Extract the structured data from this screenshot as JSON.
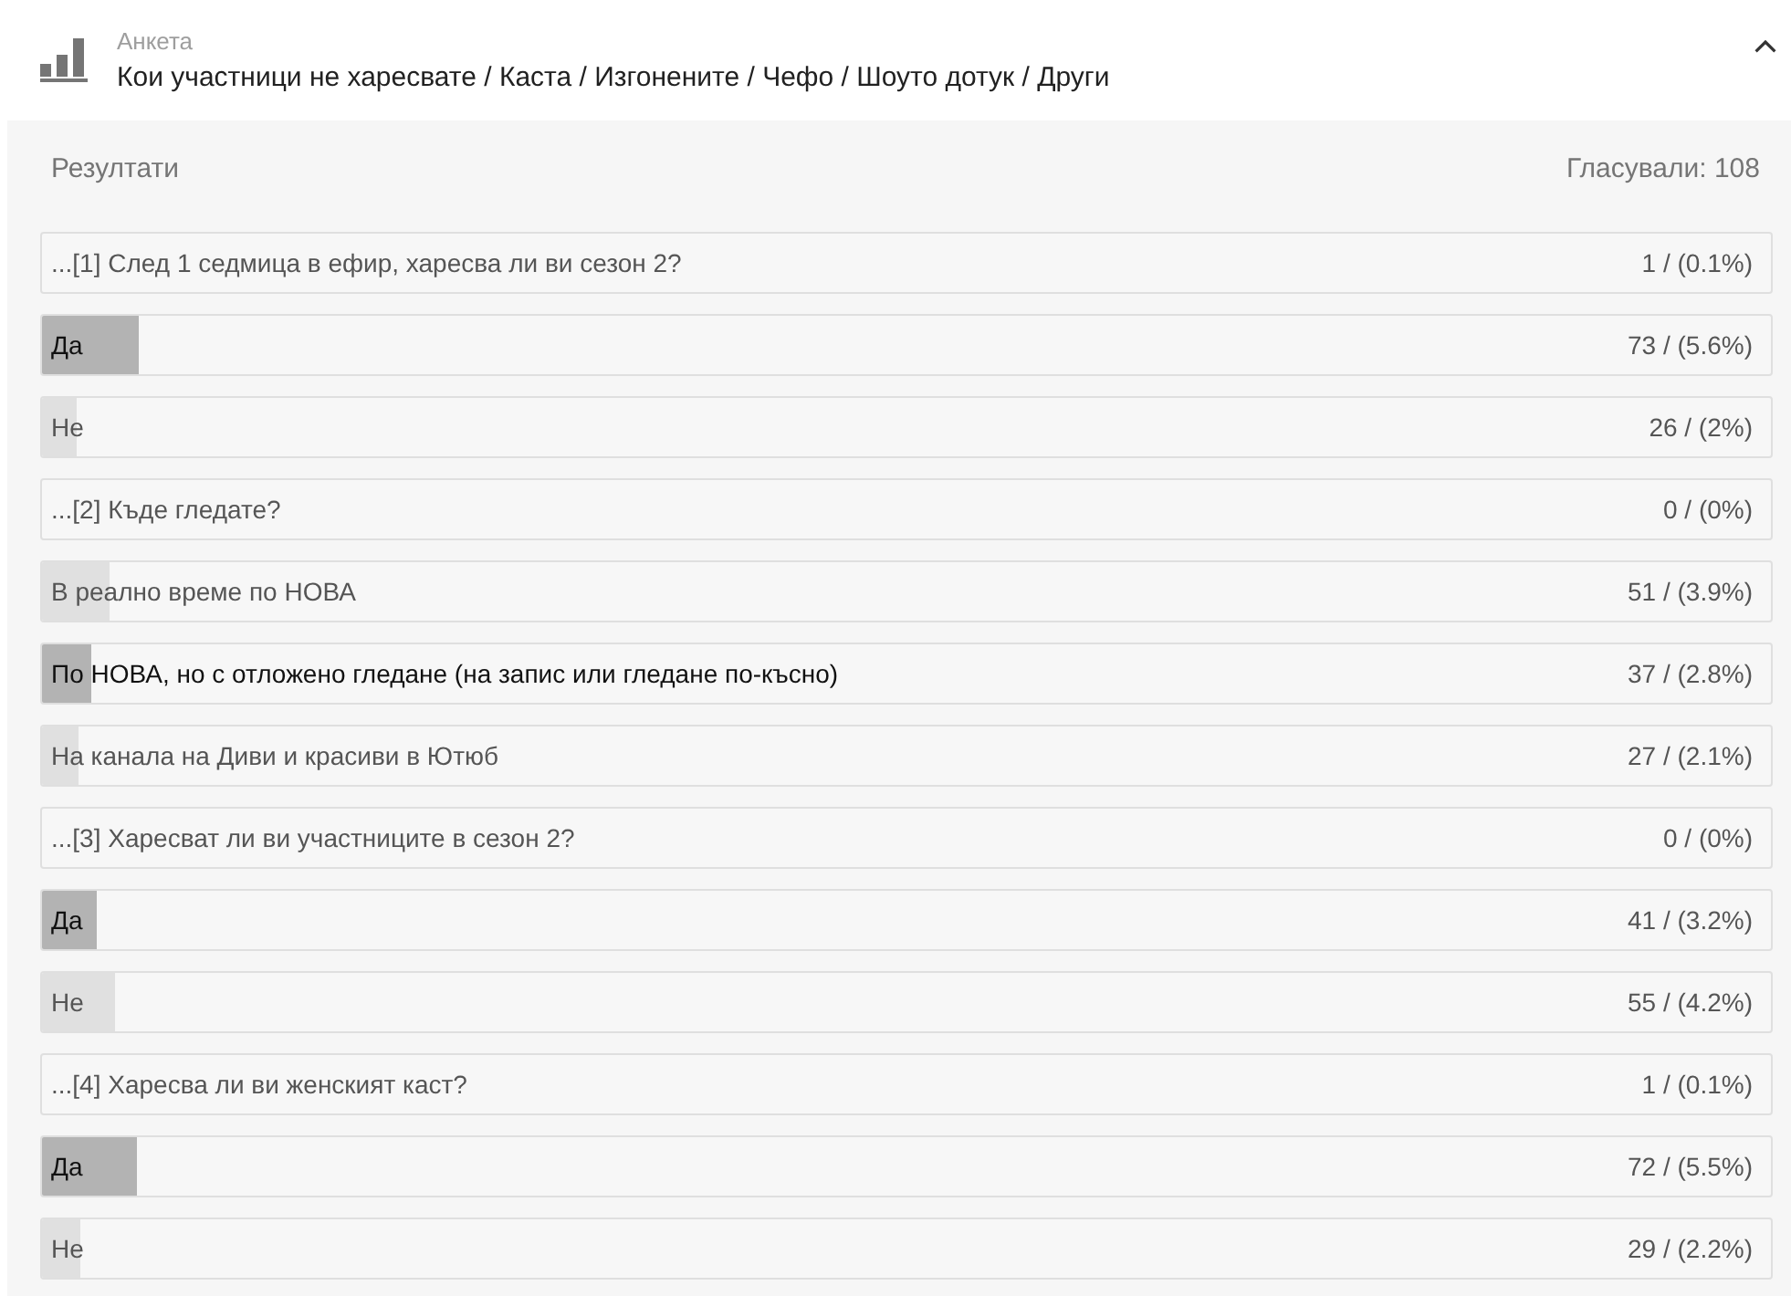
{
  "header": {
    "label": "Анкета",
    "title": "Кои участници не харесвате / Каста / Изгонените / Чефо / Шоуто дотук / Други",
    "expanded": true
  },
  "results": {
    "title": "Резултати",
    "votes": "Гласували: 108",
    "rows": [
      {
        "kind": "question",
        "label": "...[1] След 1 седмица в ефир, харесва ли ви сезон 2?",
        "count": "1 / (0.1%)"
      },
      {
        "kind": "answer",
        "label": "Да",
        "count": "73 / (5.6%)",
        "level": 0.056,
        "selected": true
      },
      {
        "kind": "answer",
        "label": "Не",
        "count": "26 / (2%)",
        "level": 0.02,
        "selected": false
      },
      {
        "kind": "question",
        "label": "...[2] Къде гледате?",
        "count": "0 / (0%)"
      },
      {
        "kind": "answer",
        "label": "В реално време по НОВА",
        "count": "51 / (3.9%)",
        "level": 0.039,
        "selected": false
      },
      {
        "kind": "answer",
        "label": "По НОВА, но с отложено гледане (на запис или гледане по-късно)",
        "count": "37 / (2.8%)",
        "level": 0.028,
        "selected": true
      },
      {
        "kind": "answer",
        "label": "На канала на Диви и красиви в Ютюб",
        "count": "27 / (2.1%)",
        "level": 0.021,
        "selected": false
      },
      {
        "kind": "question",
        "label": "...[3] Харесват ли ви участниците в сезон 2?",
        "count": "0 / (0%)"
      },
      {
        "kind": "answer",
        "label": "Да",
        "count": "41 / (3.2%)",
        "level": 0.032,
        "selected": true
      },
      {
        "kind": "answer",
        "label": "Не",
        "count": "55 / (4.2%)",
        "level": 0.042,
        "selected": false
      },
      {
        "kind": "question",
        "label": "...[4] Харесва ли ви женският каст?",
        "count": "1 / (0.1%)"
      },
      {
        "kind": "answer",
        "label": "Да",
        "count": "72 / (5.5%)",
        "level": 0.055,
        "selected": true
      },
      {
        "kind": "answer",
        "label": "Не",
        "count": "29 / (2.2%)",
        "level": 0.022,
        "selected": false
      }
    ]
  }
}
